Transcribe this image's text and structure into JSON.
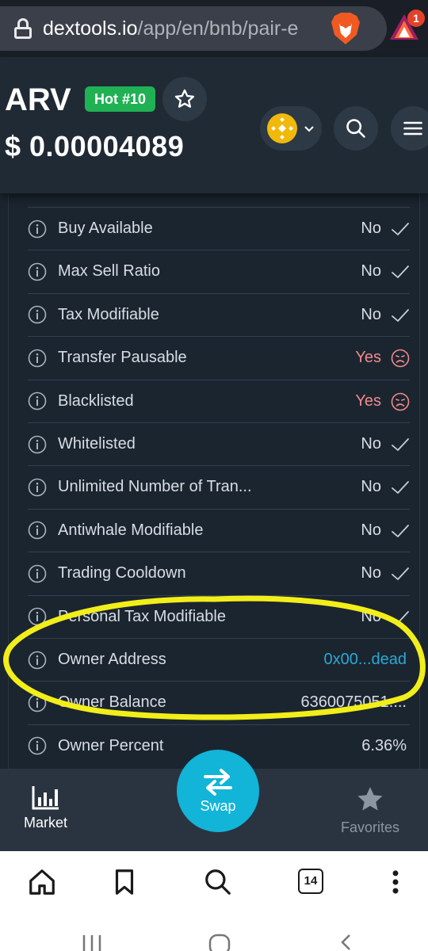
{
  "browser": {
    "url_host": "dextools.io",
    "url_path": "/app/en/bnb/pair-e",
    "notification_count": "1"
  },
  "token": {
    "symbol": "ARV",
    "hot_badge": "Hot #10",
    "price": "$ 0.00004089",
    "chain_icon": "bnb-chain-icon"
  },
  "audit": {
    "rows": [
      {
        "label": "Buy Available",
        "value": "No",
        "status": "ok"
      },
      {
        "label": "Max Sell Ratio",
        "value": "No",
        "status": "ok"
      },
      {
        "label": "Tax Modifiable",
        "value": "No",
        "status": "ok"
      },
      {
        "label": "Transfer Pausable",
        "value": "Yes",
        "status": "warn"
      },
      {
        "label": "Blacklisted",
        "value": "Yes",
        "status": "warn"
      },
      {
        "label": "Whitelisted",
        "value": "No",
        "status": "ok"
      },
      {
        "label": "Unlimited Number of Tran...",
        "value": "No",
        "status": "ok"
      },
      {
        "label": "Antiwhale Modifiable",
        "value": "No",
        "status": "ok"
      },
      {
        "label": "Trading Cooldown",
        "value": "No",
        "status": "ok"
      },
      {
        "label": "Personal Tax Modifiable",
        "value": "No",
        "status": "ok"
      },
      {
        "label": "Owner Address",
        "value": "0x00...dead",
        "status": "link"
      },
      {
        "label": "Owner Balance",
        "value": "6360075051....",
        "status": "plain"
      },
      {
        "label": "Owner Percent",
        "value": "6.36%",
        "status": "plain"
      }
    ]
  },
  "app_nav": {
    "market_label": "Market",
    "swap_label": "Swap",
    "favorites_label": "Favorites"
  },
  "toolbar": {
    "tab_count": "14"
  },
  "colors": {
    "accent": "#12b4d8",
    "hot": "#20b154",
    "ok": "#d7dde3",
    "warn": "#f08a8a",
    "link": "#2aa9d4",
    "highlight": "#f2ee1a"
  }
}
